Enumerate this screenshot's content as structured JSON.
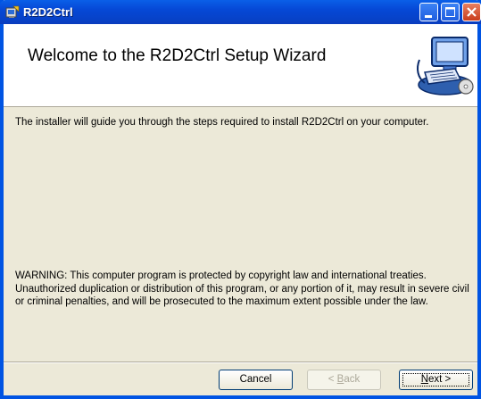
{
  "window": {
    "title": "R2D2Ctrl"
  },
  "header": {
    "title": "Welcome to the R2D2Ctrl Setup Wizard"
  },
  "body": {
    "intro": "The installer will guide you through the steps required to install R2D2Ctrl on your computer.",
    "warning": "WARNING: This computer program is protected by copyright law and international treaties. Unauthorized duplication or distribution of this program, or any portion of it, may result in severe civil or criminal penalties, and will be prosecuted to the maximum extent possible under the law."
  },
  "buttons": {
    "cancel": "Cancel",
    "back_prefix": "< ",
    "back_accel": "B",
    "back_rest": "ack",
    "next_accel": "N",
    "next_rest": "ext >"
  },
  "icons": {
    "app": "installer-icon",
    "header": "computer-setup-icon",
    "minimize": "minimize-icon",
    "maximize": "maximize-icon",
    "close": "close-icon"
  }
}
